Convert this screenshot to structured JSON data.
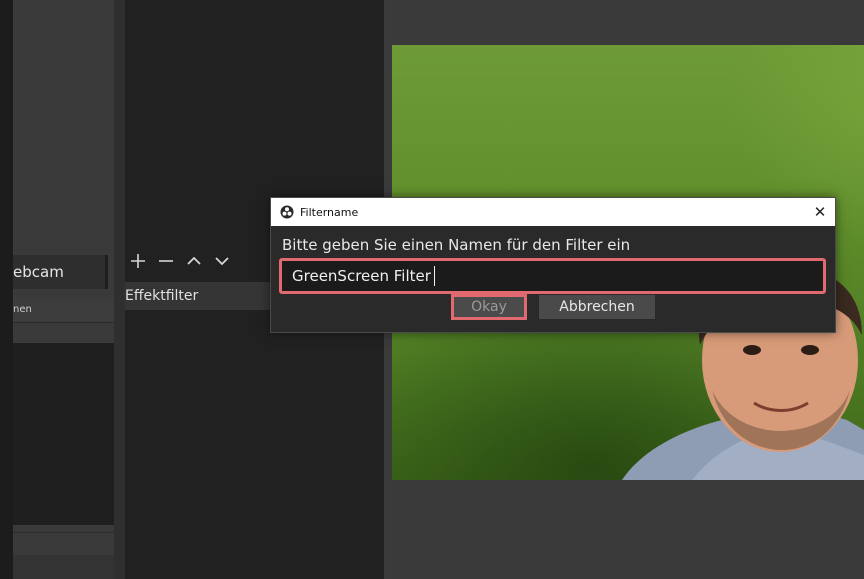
{
  "left_panel": {
    "source_label": "ebcam",
    "header_label": "nen"
  },
  "filter_panel": {
    "toolbar": {
      "add": "+",
      "remove": "−",
      "move_up": "∧",
      "move_down": "∨"
    },
    "section_title": "Effektfilter"
  },
  "dialog": {
    "title": "Filtername",
    "close_glyph": "✕",
    "prompt": "Bitte geben Sie einen Namen für den Filter ein",
    "input_value": "GreenScreen Filter",
    "ok_label": "Okay",
    "cancel_label": "Abbrechen"
  },
  "colors": {
    "highlight": "#e06a6f",
    "green_screen": "#5f8e2b"
  },
  "icons": {
    "app": "obs-logo-icon",
    "close": "close-icon"
  }
}
